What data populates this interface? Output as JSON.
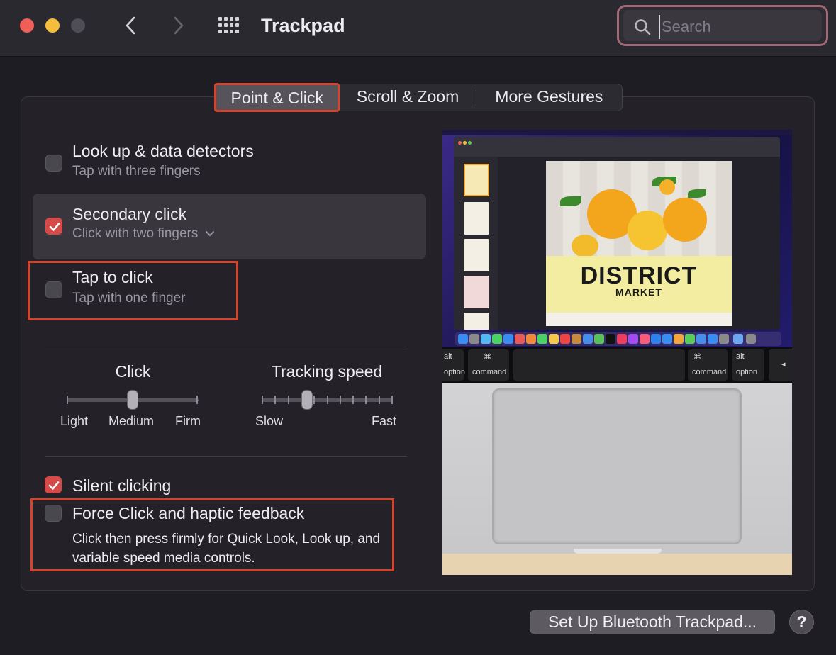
{
  "window": {
    "title": "Trackpad",
    "search_placeholder": "Search"
  },
  "tabs": [
    {
      "label": "Point & Click",
      "selected": true
    },
    {
      "label": "Scroll & Zoom",
      "selected": false
    },
    {
      "label": "More Gestures",
      "selected": false
    }
  ],
  "options": {
    "lookup": {
      "title": "Look up & data detectors",
      "subtitle": "Tap with three fingers",
      "checked": false
    },
    "secondary": {
      "title": "Secondary click",
      "subtitle": "Click with two fingers",
      "checked": true
    },
    "tap": {
      "title": "Tap to click",
      "subtitle": "Tap with one finger",
      "checked": false
    },
    "silent": {
      "title": "Silent clicking",
      "checked": true
    },
    "force": {
      "title": "Force Click and haptic feedback",
      "description": "Click then press firmly for Quick Look, Look up, and variable speed media controls.",
      "checked": false
    }
  },
  "sliders": {
    "click": {
      "title": "Click",
      "labels": [
        "Light",
        "Medium",
        "Firm"
      ],
      "value": "Medium"
    },
    "tracking": {
      "title": "Tracking speed",
      "min_label": "Slow",
      "max_label": "Fast",
      "level_fraction": 0.33
    }
  },
  "preview": {
    "poster_title": "DISTRICT",
    "poster_subtitle": "MARKET",
    "keys": {
      "alt_left": "alt",
      "option_left": "option",
      "cmd_symbol": "⌘",
      "command_left": "command",
      "command_right": "command",
      "alt_right": "alt",
      "option_right": "option"
    }
  },
  "buttons": {
    "bluetooth": "Set Up Bluetooth Trackpad...",
    "help": "?"
  },
  "colors": {
    "accent_red": "#d64a4a",
    "annotation_red": "#d6432c",
    "background": "#1e1d23"
  }
}
